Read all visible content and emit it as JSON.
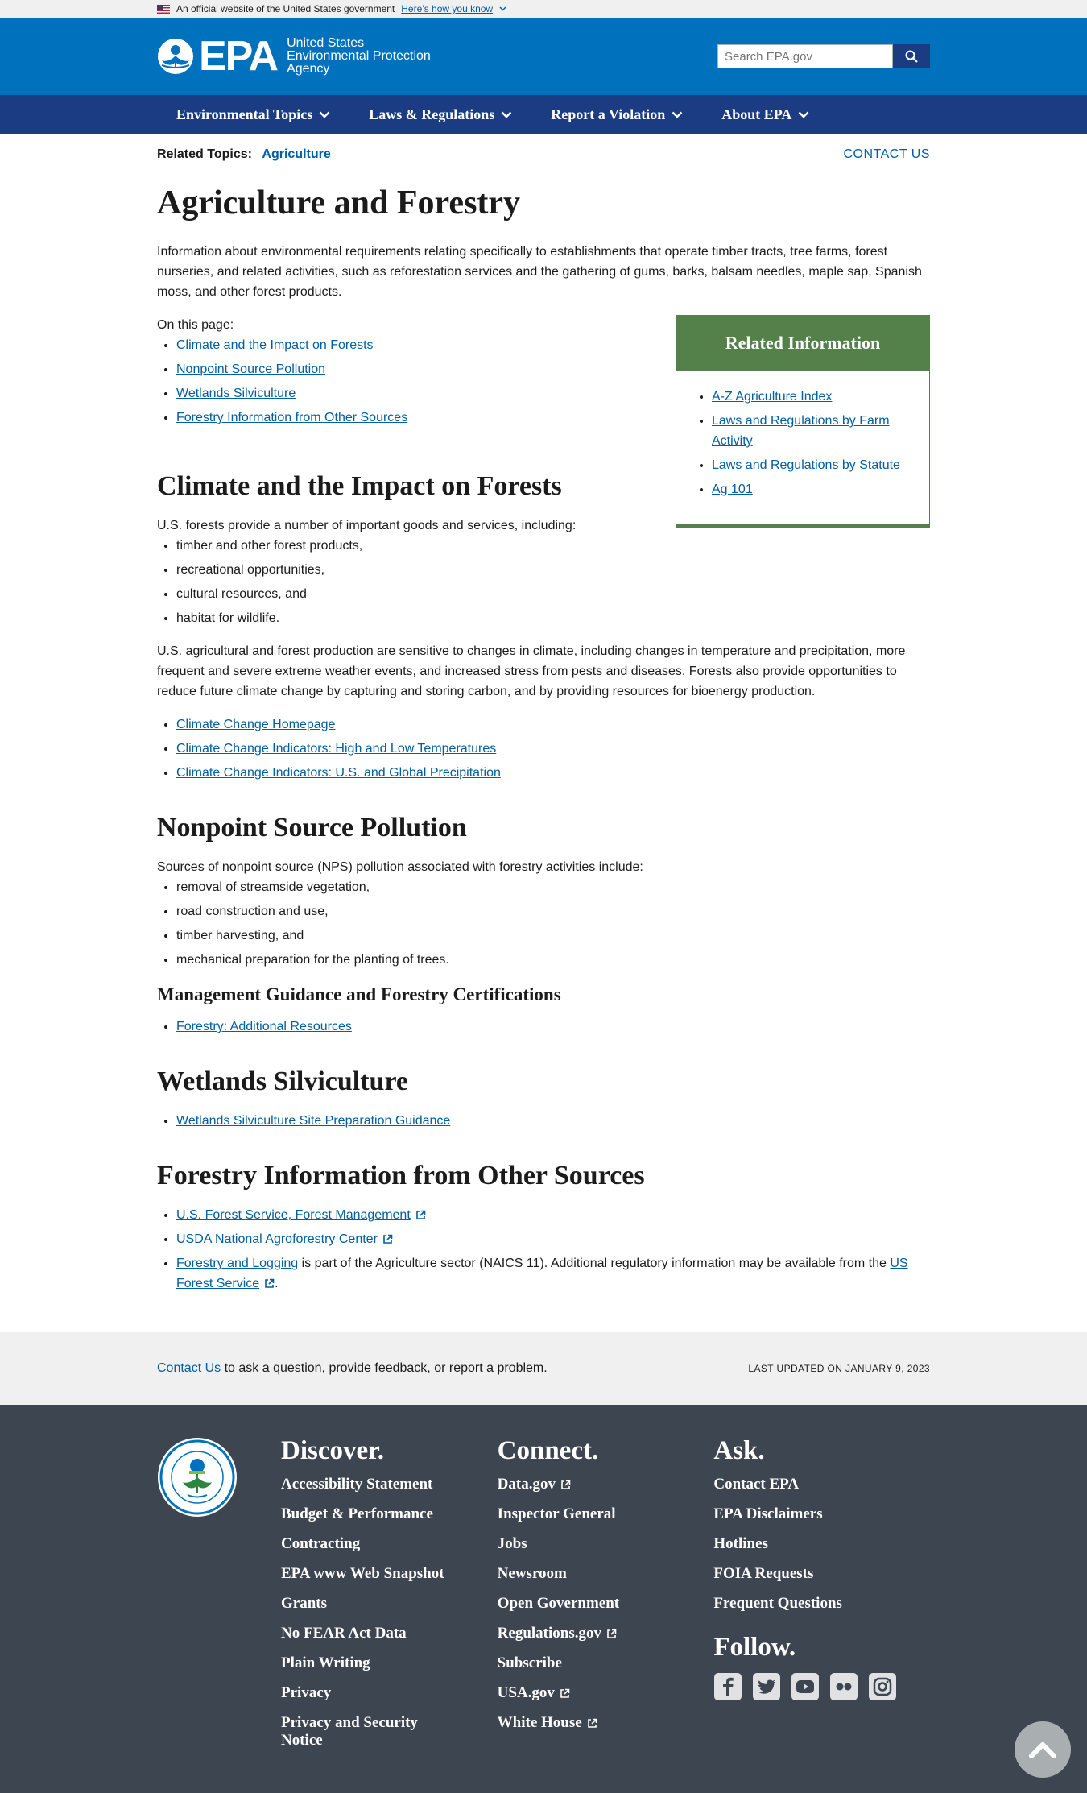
{
  "gov_banner": {
    "text": "An official website of the United States government",
    "link": "Here’s how you know"
  },
  "header": {
    "logo_word": "EPA",
    "logo_line1": "United States",
    "logo_line2": "Environmental Protection",
    "logo_line3": "Agency",
    "search_placeholder": "Search EPA.gov",
    "colors": {
      "header_bg": "#0071bc",
      "nav_bg": "#1b3b82"
    }
  },
  "nav": {
    "items": [
      "Environmental Topics",
      "Laws & Regulations",
      "Report a Violation",
      "About EPA"
    ]
  },
  "related_topics": {
    "label": "Related Topics:",
    "link": "Agriculture"
  },
  "contact_us_top": "CONTACT US",
  "page": {
    "title": "Agriculture and Forestry",
    "intro": "Information about environmental requirements relating specifically to establishments that operate timber tracts, tree farms, forest nurseries, and related activities, such as reforestation services and the gathering of gums, barks, balsam needles, maple sap, Spanish moss, and other forest products.",
    "on_this_page_label": "On this page:",
    "on_this_page": [
      "Climate and the Impact on Forests",
      "Nonpoint Source Pollution",
      "Wetlands Silviculture",
      "Forestry Information from Other Sources"
    ]
  },
  "sidebar": {
    "title": "Related Information",
    "links": [
      "A-Z Agriculture Index",
      "Laws and Regulations by Farm Activity",
      "Laws and Regulations by Statute",
      "Ag 101"
    ],
    "color": "#538149"
  },
  "climate": {
    "heading": "Climate and the Impact on Forests",
    "lead": "U.S. forests provide a number of important goods and services, including:",
    "items": [
      "timber and other forest products,",
      "recreational opportunities,",
      "cultural resources, and",
      "habitat for wildlife."
    ],
    "paragraph": "U.S. agricultural and forest production are sensitive to changes in climate, including changes in temperature and precipitation, more frequent and severe extreme weather events, and increased stress from pests and diseases.  Forests also provide opportunities to reduce future climate change by capturing and storing carbon, and by providing resources for bioenergy production.",
    "links": [
      "Climate Change Homepage",
      "Climate Change Indicators: High and Low Temperatures",
      "Climate Change Indicators: U.S. and Global Precipitation"
    ]
  },
  "nps": {
    "heading": "Nonpoint Source Pollution",
    "lead": "Sources of nonpoint source (NPS) pollution associated with forestry activities include:",
    "items": [
      "removal of streamside vegetation,",
      "road construction and use,",
      "timber harvesting, and",
      "mechanical preparation for the planting of trees."
    ],
    "subheading": "Management Guidance and Forestry Certifications",
    "link": "Forestry: Additional Resources"
  },
  "wetlands": {
    "heading": "Wetlands Silviculture",
    "link": "Wetlands Silviculture Site Preparation Guidance"
  },
  "other": {
    "heading": "Forestry Information from Other Sources",
    "link1": "U.S. Forest Service, Forest Management",
    "link2": "USDA National Agroforestry Center",
    "link3": "Forestry and Logging",
    "text3a": " is part of the Agriculture sector (NAICS 11). Additional regulatory information may be available from the ",
    "link4": "US Forest Service",
    "text3b": "."
  },
  "feedback": {
    "link": "Contact Us",
    "text": " to ask a question, provide feedback, or report a problem.",
    "updated": "LAST UPDATED ON JANUARY 9, 2023"
  },
  "footer": {
    "discover": {
      "heading": "Discover.",
      "links": [
        "Accessibility Statement",
        "Budget & Performance",
        "Contracting",
        "EPA www Web Snapshot",
        "Grants",
        "No FEAR Act Data",
        "Plain Writing",
        "Privacy",
        "Privacy and Security Notice"
      ]
    },
    "connect": {
      "heading": "Connect.",
      "links": [
        "Data.gov",
        "Inspector General",
        "Jobs",
        "Newsroom",
        "Open Government",
        "Regulations.gov",
        "Subscribe",
        "USA.gov",
        "White House"
      ]
    },
    "ask": {
      "heading": "Ask.",
      "links": [
        "Contact EPA",
        "EPA Disclaimers",
        "Hotlines",
        "FOIA Requests",
        "Frequent Questions"
      ]
    },
    "follow": {
      "heading": "Follow.",
      "icons": [
        "facebook-icon",
        "twitter-icon",
        "youtube-icon",
        "flickr-icon",
        "instagram-icon"
      ]
    },
    "bg": "#3d4551"
  }
}
